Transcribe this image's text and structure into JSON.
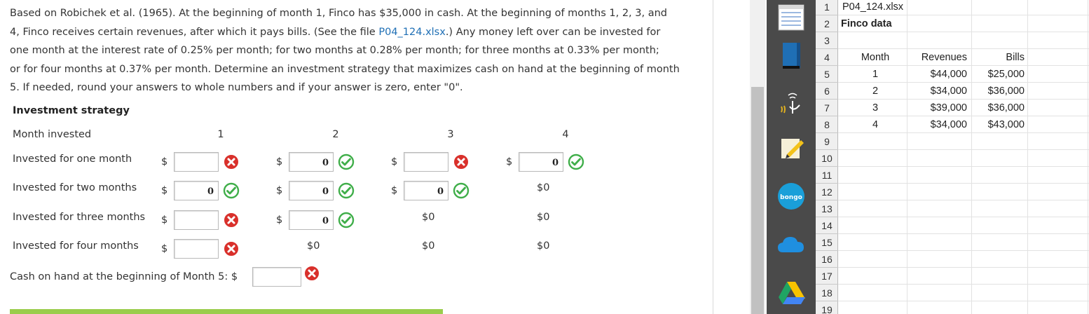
{
  "question": {
    "para_1": "Based on Robichek et al. (1965). At the beginning of month 1, Finco has $35,000 in cash. At the beginning of months 1, 2, 3, and",
    "para_2a": "4, Finco receives certain revenues, after which it pays bills. (See the file ",
    "para_2_file": "P04_124.xlsx",
    "para_2b": ".) Any money left over can be invested for",
    "para_3": "one month at the interest rate of 0.25% per month; for two months at 0.28% per month; for three months at 0.33% per month;",
    "para_4": "or for four months at 0.37% per month. Determine an investment strategy that maximizes cash on hand at the beginning of month",
    "para_5": "5. If needed, round your answers to whole numbers and if your answer is zero, enter \"0\"."
  },
  "strategy": {
    "heading": "Investment strategy",
    "month_label": "Month invested",
    "months": [
      "1",
      "2",
      "3",
      "4"
    ],
    "currency": "$",
    "rows": [
      {
        "label": "Invested for one month",
        "cells": [
          {
            "value": "",
            "status": "wrong"
          },
          {
            "value": "0",
            "status": "correct"
          },
          {
            "value": "",
            "status": "wrong"
          },
          {
            "value": "0",
            "status": "correct"
          }
        ]
      },
      {
        "label": "Invested for two months",
        "cells": [
          {
            "value": "0",
            "status": "correct"
          },
          {
            "value": "0",
            "status": "correct"
          },
          {
            "value": "0",
            "status": "correct"
          },
          {
            "static": "$0"
          }
        ]
      },
      {
        "label": "Invested for three months",
        "cells": [
          {
            "value": "",
            "status": "wrong"
          },
          {
            "value": "0",
            "status": "correct"
          },
          {
            "static": "$0"
          },
          {
            "static": "$0"
          }
        ]
      },
      {
        "label": "Invested for four months",
        "cells": [
          {
            "value": "",
            "status": "wrong"
          },
          {
            "static": "$0"
          },
          {
            "static": "$0"
          },
          {
            "static": "$0"
          }
        ]
      }
    ],
    "cash_label": "Cash on hand at the beginning of Month 5: $",
    "cash_value": "",
    "cash_status": "wrong"
  },
  "colors": {
    "correct": "#3fae49",
    "wrong": "#d9302b",
    "progress": "#9acd4c",
    "link": "#1f6fb5"
  },
  "dock": {
    "icons": [
      "notepad-icon",
      "book-icon",
      "tap-hand-icon",
      "sticky-note-pen-icon",
      "bongo-icon",
      "cloud-icon",
      "google-drive-icon"
    ],
    "bongo_text": "bongo"
  },
  "sheet": {
    "row_numbers": [
      "1",
      "2",
      "3",
      "4",
      "5",
      "6",
      "7",
      "8",
      "9",
      "10",
      "11",
      "12",
      "13",
      "14",
      "15",
      "16",
      "17",
      "18",
      "19"
    ],
    "filename": "P04_124.xlsx",
    "title": "Finco data",
    "headers": {
      "month": "Month",
      "revenues": "Revenues",
      "bills": "Bills"
    },
    "rows": [
      {
        "month": "1",
        "revenues": "$44,000",
        "bills": "$25,000"
      },
      {
        "month": "2",
        "revenues": "$34,000",
        "bills": "$36,000"
      },
      {
        "month": "3",
        "revenues": "$39,000",
        "bills": "$36,000"
      },
      {
        "month": "4",
        "revenues": "$34,000",
        "bills": "$43,000"
      }
    ]
  }
}
